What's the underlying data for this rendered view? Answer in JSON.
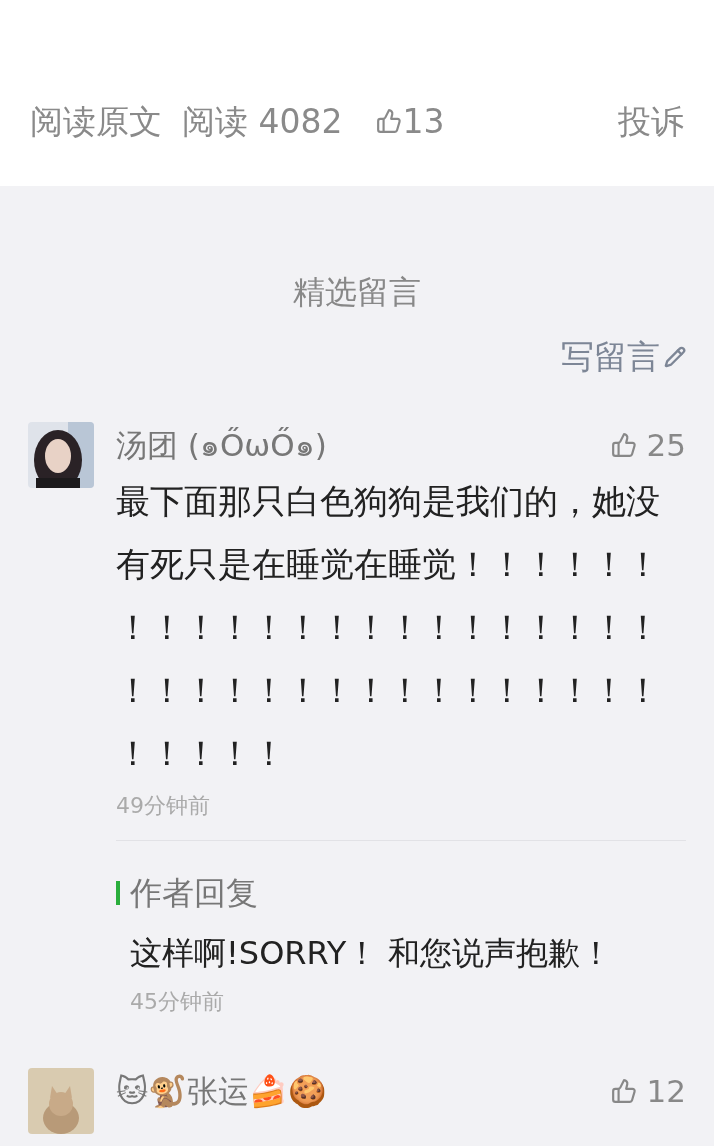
{
  "footer_bar": {
    "read_original": "阅读原文",
    "reads": "阅读 4082",
    "likes": "13",
    "report": "投诉"
  },
  "comments_section": {
    "title": "精选留言",
    "write_comment": "写留言",
    "comments": [
      {
        "author": "汤团 (๑ŐωŐ๑)",
        "likes": "25",
        "text": "最下面那只白色狗狗是我们的，她没有死只是在睡觉在睡觉！！！！！！！！！！！！！！！！！！！！！！！！！！！！！！！！！！！！！！！！！！！",
        "time": "49分钟前",
        "reply": {
          "label": "作者回复",
          "text": "这样啊!SORRY！ 和您说声抱歉！",
          "time": "45分钟前"
        }
      },
      {
        "author": "🐱🐒张运🍰🍪",
        "likes": "12"
      }
    ]
  }
}
